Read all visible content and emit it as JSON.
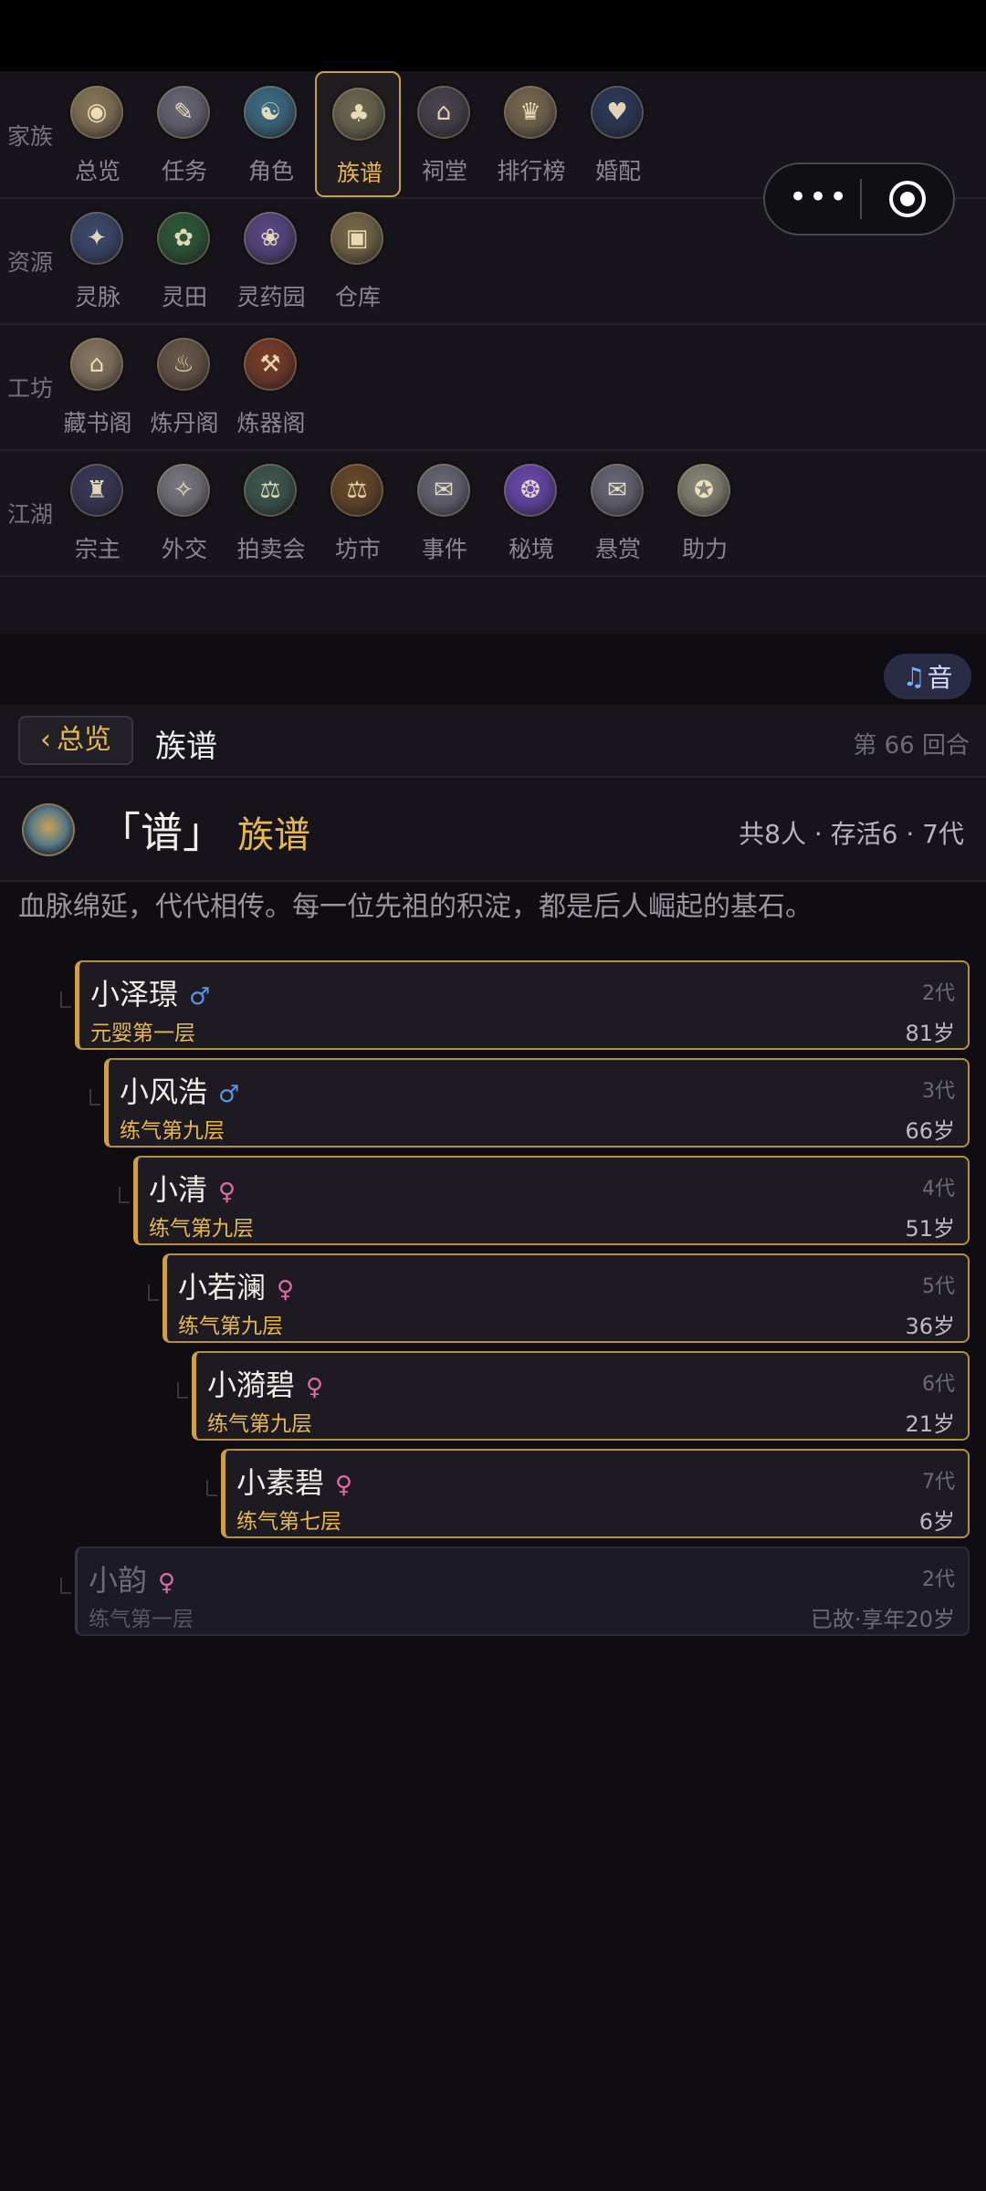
{
  "nav": {
    "rows": [
      {
        "label": "家族",
        "items": [
          {
            "label": "总览",
            "icon": "overview-icon",
            "color": "#8a7a5a",
            "glyph": "◉"
          },
          {
            "label": "任务",
            "icon": "quest-icon",
            "color": "#6a6a78",
            "glyph": "✎"
          },
          {
            "label": "角色",
            "icon": "character-icon",
            "color": "#3e6e86",
            "glyph": "☯"
          },
          {
            "label": "族谱",
            "icon": "family-tree-icon",
            "color": "#6e6a52",
            "glyph": "♣",
            "active": true
          },
          {
            "label": "祠堂",
            "icon": "ancestral-hall-icon",
            "color": "#4a4550",
            "glyph": "⌂"
          },
          {
            "label": "排行榜",
            "icon": "leaderboard-icon",
            "color": "#7a6a52",
            "glyph": "♛"
          },
          {
            "label": "婚配",
            "icon": "marriage-icon",
            "color": "#2e3b5a",
            "glyph": "♥"
          }
        ]
      },
      {
        "label": "资源",
        "items": [
          {
            "label": "灵脉",
            "icon": "spirit-vein-icon",
            "color": "#3e4a6e",
            "glyph": "✦"
          },
          {
            "label": "灵田",
            "icon": "spirit-field-icon",
            "color": "#2f5a3a",
            "glyph": "✿"
          },
          {
            "label": "灵药园",
            "icon": "herb-garden-icon",
            "color": "#5a4a86",
            "glyph": "❀"
          },
          {
            "label": "仓库",
            "icon": "warehouse-icon",
            "color": "#7a6a4a",
            "glyph": "▣"
          }
        ]
      },
      {
        "label": "工坊",
        "items": [
          {
            "label": "藏书阁",
            "icon": "library-icon",
            "color": "#8a7a62",
            "glyph": "⌂"
          },
          {
            "label": "炼丹阁",
            "icon": "alchemy-icon",
            "color": "#6a5a4a",
            "glyph": "♨"
          },
          {
            "label": "炼器阁",
            "icon": "forge-icon",
            "color": "#7a3e2a",
            "glyph": "⚒"
          }
        ]
      },
      {
        "label": "江湖",
        "items": [
          {
            "label": "宗主",
            "icon": "sect-master-icon",
            "color": "#3a3a5a",
            "glyph": "♜"
          },
          {
            "label": "外交",
            "icon": "diplomacy-icon",
            "color": "#7a7a82",
            "glyph": "✧"
          },
          {
            "label": "拍卖会",
            "icon": "auction-icon",
            "color": "#3e5a52",
            "glyph": "⚖"
          },
          {
            "label": "坊市",
            "icon": "market-icon",
            "color": "#6a4a2a",
            "glyph": "⚖"
          },
          {
            "label": "事件",
            "icon": "event-icon",
            "color": "#6a6a78",
            "glyph": "✉"
          },
          {
            "label": "秘境",
            "icon": "secret-realm-icon",
            "color": "#6a4ab0",
            "glyph": "❂"
          },
          {
            "label": "悬赏",
            "icon": "bounty-icon",
            "color": "#6a6a78",
            "glyph": "✉"
          },
          {
            "label": "助力",
            "icon": "boost-icon",
            "color": "#8a8a7a",
            "glyph": "✪"
          }
        ]
      }
    ]
  },
  "music": {
    "label": "音",
    "icon": "music-note-icon"
  },
  "header": {
    "back_label": "总览",
    "title": "族谱",
    "round": "第 66 回合"
  },
  "page": {
    "bracket": "「谱」",
    "name": "族谱",
    "stats": "共8人 · 存活6 · 7代",
    "description": "血脉绵延，代代相传。每一位先祖的积淀，都是后人崛起的基石。"
  },
  "members": [
    {
      "name": "小泽璟",
      "gender": "♂",
      "gender_class": "male",
      "realm": "元婴第一层",
      "generation": "2代",
      "age": "81岁",
      "deceased": false
    },
    {
      "name": "小风浩",
      "gender": "♂",
      "gender_class": "male",
      "realm": "练气第九层",
      "generation": "3代",
      "age": "66岁",
      "deceased": false
    },
    {
      "name": "小清",
      "gender": "♀",
      "gender_class": "female",
      "realm": "练气第九层",
      "generation": "4代",
      "age": "51岁",
      "deceased": false
    },
    {
      "name": "小若澜",
      "gender": "♀",
      "gender_class": "female",
      "realm": "练气第九层",
      "generation": "5代",
      "age": "36岁",
      "deceased": false
    },
    {
      "name": "小漪碧",
      "gender": "♀",
      "gender_class": "female",
      "realm": "练气第九层",
      "generation": "6代",
      "age": "21岁",
      "deceased": false
    },
    {
      "name": "小素碧",
      "gender": "♀",
      "gender_class": "female",
      "realm": "练气第七层",
      "generation": "7代",
      "age": "6岁",
      "deceased": false
    },
    {
      "name": "小韵",
      "gender": "♀",
      "gender_class": "female",
      "realm": "练气第一层",
      "generation": "2代",
      "age": "已故·享年20岁",
      "deceased": true
    }
  ]
}
